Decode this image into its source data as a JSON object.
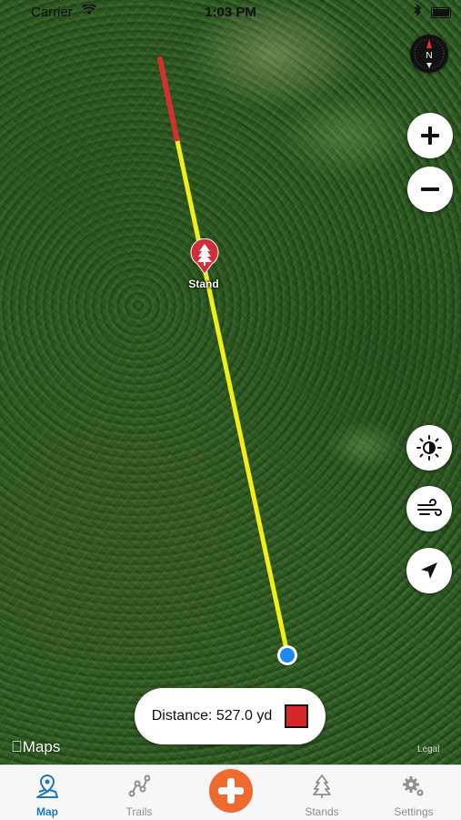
{
  "status_bar": {
    "carrier": "Carrier",
    "time": "1:03 PM"
  },
  "map": {
    "pin_label": "Stand",
    "maps_logo": "Maps",
    "legal": "Legal",
    "route_colors": {
      "near": "#f1ee16",
      "far": "#d22f2f"
    }
  },
  "controls": {
    "compass_letter": "N",
    "zoom_in": "plus-icon",
    "zoom_out": "minus-icon",
    "daylight": "sun-icon",
    "wind": "wind-icon",
    "locate": "location-arrow-icon"
  },
  "distance": {
    "label": "Distance: 527.0 yd",
    "swatch_color": "#d8262d"
  },
  "tabs": [
    {
      "label": "Map",
      "icon": "map-pin-icon",
      "active": true
    },
    {
      "label": "Trails",
      "icon": "trails-icon",
      "active": false
    },
    {
      "label": "Stands",
      "icon": "tree-icon",
      "active": false
    },
    {
      "label": "Settings",
      "icon": "gears-icon",
      "active": false
    }
  ],
  "accent_color": "#1a78c2",
  "add_button_color": "#ee6a2f"
}
